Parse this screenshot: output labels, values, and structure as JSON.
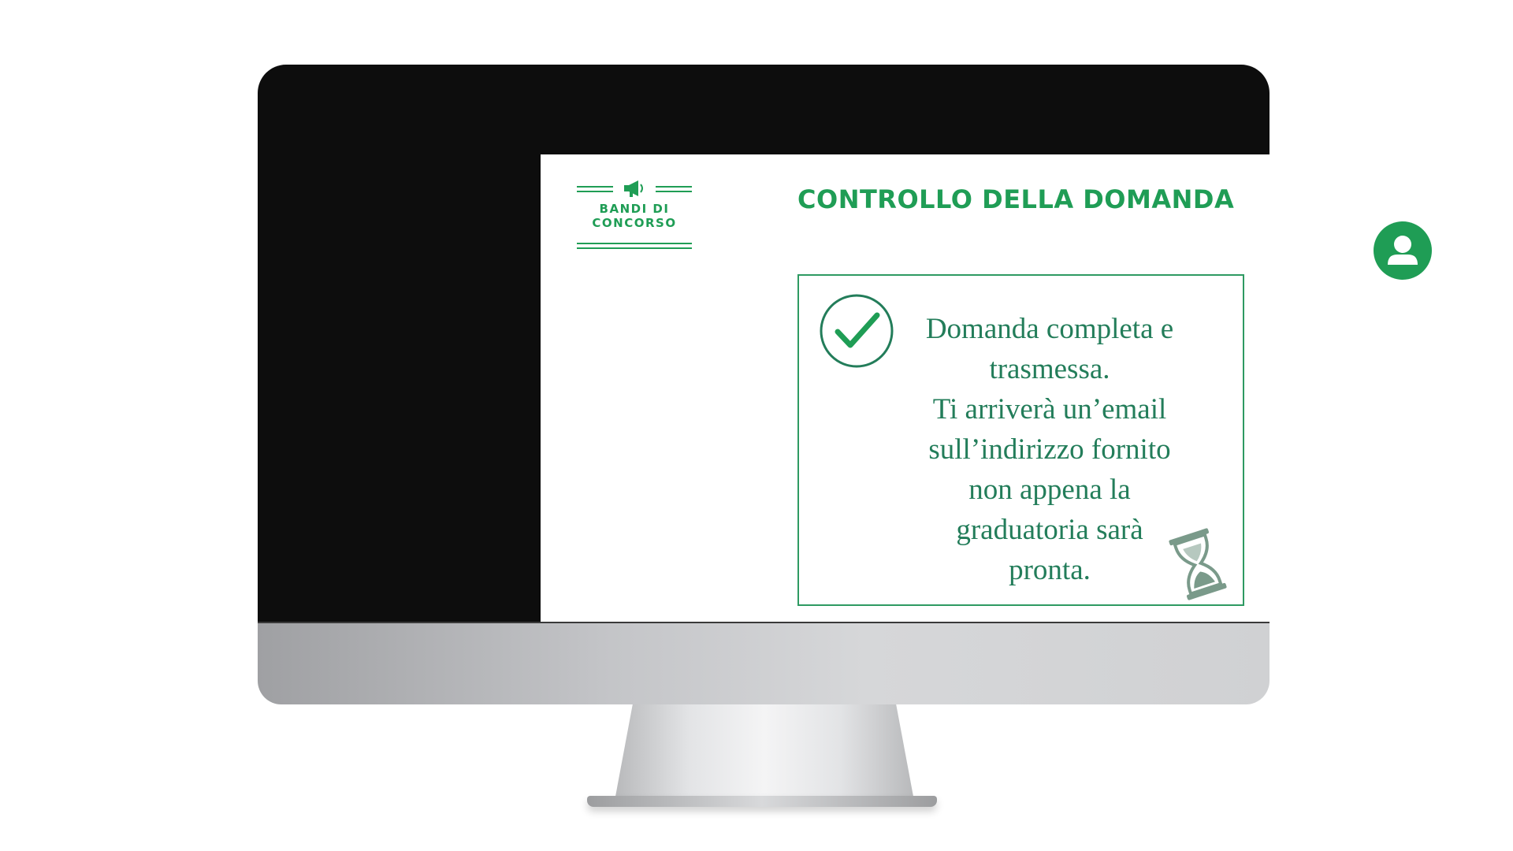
{
  "app": {
    "logo_line1": "BANDI DI",
    "logo_line2": "CONCORSO",
    "title": "CONTROLLO DELLA DOMANDA"
  },
  "status_card": {
    "message_lines": [
      "Domanda completa e",
      "trasmessa.",
      "Ti arriverà un’email",
      "sull’indirizzo fornito",
      "non appena la",
      "graduatoria sarà",
      "pronta."
    ]
  },
  "icons": {
    "logo": "megaphone-icon",
    "user": "user-avatar-icon",
    "status": "checkmark-circle-icon",
    "waiting": "hourglass-icon"
  },
  "colors": {
    "brand_green": "#1f9d55",
    "text_green": "#237d5a",
    "hourglass_gray": "#7a9a8a"
  }
}
